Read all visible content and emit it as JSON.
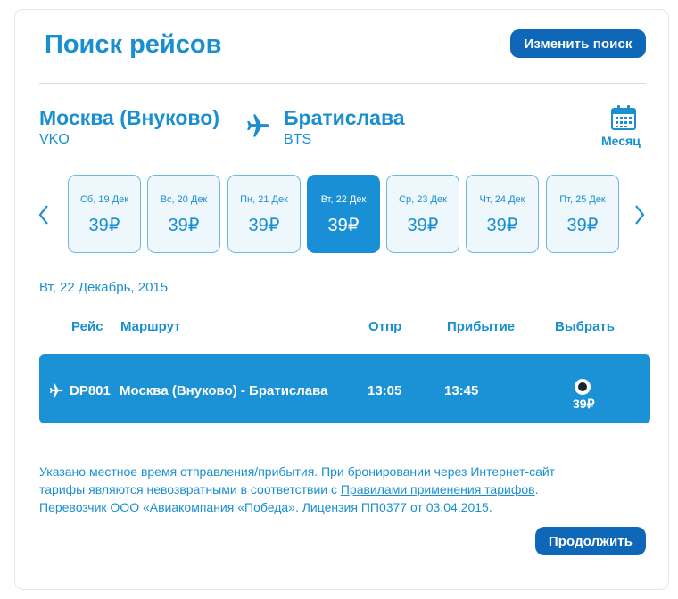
{
  "header": {
    "title": "Поиск рейсов",
    "change_search_label": "Изменить поиск"
  },
  "route": {
    "from_city": "Москва (Внуково)",
    "from_code": "VKO",
    "to_city": "Братислава",
    "to_code": "BTS",
    "month_label": "Месяц"
  },
  "dates": [
    {
      "label": "Сб, 19 Дек",
      "price": "39₽",
      "selected": false
    },
    {
      "label": "Вс, 20 Дек",
      "price": "39₽",
      "selected": false
    },
    {
      "label": "Пн, 21 Дек",
      "price": "39₽",
      "selected": false
    },
    {
      "label": "Вт, 22 Дек",
      "price": "39₽",
      "selected": true
    },
    {
      "label": "Ср, 23 Дек",
      "price": "39₽",
      "selected": false
    },
    {
      "label": "Чт, 24 Дек",
      "price": "39₽",
      "selected": false
    },
    {
      "label": "Пт, 25 Дек",
      "price": "39₽",
      "selected": false
    }
  ],
  "selected_date_heading": "Вт, 22 Декабрь, 2015",
  "table": {
    "headers": {
      "flight": "Рейс",
      "route": "Маршрут",
      "departure": "Отпр",
      "arrival": "Прибытие",
      "select": "Выбрать"
    },
    "rows": [
      {
        "flight": "DP801",
        "route": "Москва (Внуково) - Братислава",
        "departure": "13:05",
        "arrival": "13:45",
        "price": "39₽",
        "selected": true
      }
    ]
  },
  "notice": {
    "line1": "Указано местное время отправления/прибытия. При бронировании через Интернет-сайт",
    "line2_before": "тарифы являются невозвратными в соответствии с ",
    "line2_link": "Правилами применения тарифов",
    "line2_after": ".",
    "line3": "Перевозчик ООО «Авиакомпания «Победа». Лицензия ПП0377 от 03.04.2015."
  },
  "footer": {
    "continue_label": "Продолжить"
  },
  "colors": {
    "accent": "#1a8fd0",
    "button": "#0f67b8",
    "selected_fill": "#198fd6"
  }
}
